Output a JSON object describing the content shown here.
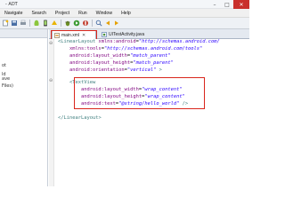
{
  "window": {
    "title": "- ADT",
    "controls": {
      "minimize": "–",
      "maximize": "□",
      "close": "✕"
    }
  },
  "menu": {
    "items": [
      "Navigate",
      "Search",
      "Project",
      "Run",
      "Window",
      "Help"
    ]
  },
  "toolbar": {
    "icons": [
      "new-icon",
      "save-icon",
      "print-icon",
      "android-sdk-icon",
      "avd-icon",
      "lint-icon",
      "debug-icon",
      "run-icon",
      "external-tools-icon",
      "search-icon",
      "back-icon",
      "forward-icon"
    ]
  },
  "left_panel": {
    "rows": [
      {
        "text": "ot"
      },
      {
        "text": "ld"
      },
      {
        "text": "ave"
      },
      {
        "text": "Files)"
      }
    ]
  },
  "tabs": [
    {
      "label": "main.xml",
      "active": true
    },
    {
      "label": "UITestActivity.java",
      "active": false
    }
  ],
  "editor": {
    "lines": [
      {
        "open": "<",
        "tag": "LinearLayout",
        "attr": " xmlns:android",
        "eq": "=",
        "val": "\"http://schemas.android.com/",
        "close": ""
      },
      {
        "open": "",
        "tag": "",
        "attr": "    xmlns:tools",
        "eq": "=",
        "val": "\"http://schemas.android.com/tools\"",
        "close": ""
      },
      {
        "open": "",
        "tag": "",
        "attr": "    android:layout_width",
        "eq": "=",
        "val": "\"match_parent\"",
        "close": ""
      },
      {
        "open": "",
        "tag": "",
        "attr": "    android:layout_height",
        "eq": "=",
        "val": "\"match_parent\"",
        "close": ""
      },
      {
        "open": "",
        "tag": "",
        "attr": "    android:orientation",
        "eq": "=",
        "val": "\"vertical\"",
        "close": " >"
      },
      {
        "open": "",
        "tag": "",
        "attr": "",
        "eq": "",
        "val": "",
        "close": ""
      },
      {
        "open": "    <",
        "tag": "TextView",
        "attr": "",
        "eq": "",
        "val": "",
        "close": ""
      },
      {
        "open": "",
        "tag": "",
        "attr": "        android:layout_width",
        "eq": "=",
        "val": "\"wrap_content\"",
        "close": ""
      },
      {
        "open": "",
        "tag": "",
        "attr": "        android:layout_height",
        "eq": "=",
        "val": "\"wrap_content\"",
        "close": ""
      },
      {
        "open": "",
        "tag": "",
        "attr": "        android:text",
        "eq": "=",
        "val": "\"@string/hello_world\"",
        "close": " />"
      },
      {
        "open": "",
        "tag": "",
        "attr": "",
        "eq": "",
        "val": "",
        "close": ""
      },
      {
        "open": "</",
        "tag": "LinearLayout",
        "attr": "",
        "eq": "",
        "val": "",
        "close": ">"
      }
    ]
  },
  "colors": {
    "highlight": "#d9261c",
    "tag": "#3f7f7f",
    "attribute": "#7f007f",
    "value": "#2a00ff"
  }
}
